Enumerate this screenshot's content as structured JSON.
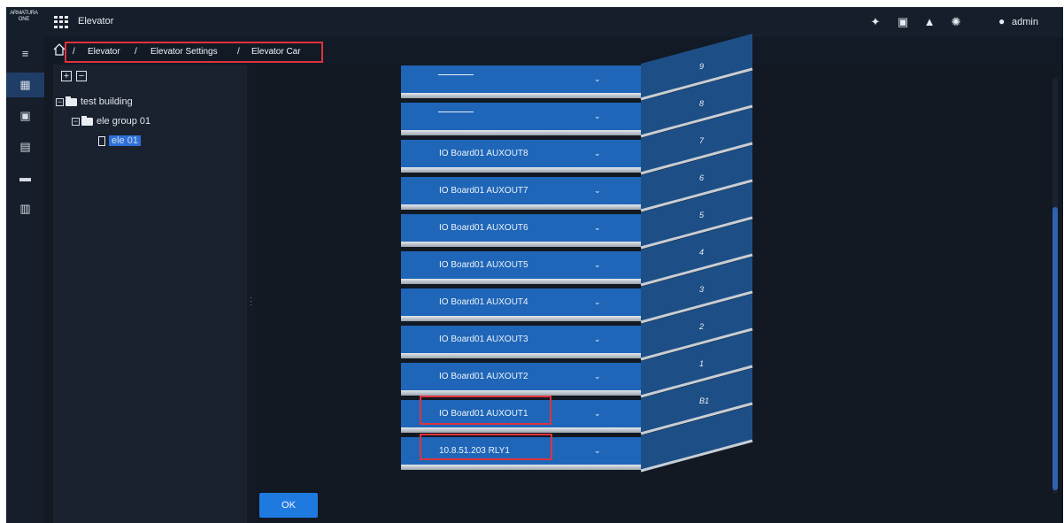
{
  "app": {
    "logo_line1": "ARMATURA",
    "logo_line2": "ONE",
    "title": "Elevator",
    "user": "admin"
  },
  "topbar_icons": [
    "pin-icon",
    "id-card-icon",
    "bell-icon",
    "alarm-icon",
    "user-icon"
  ],
  "left_nav": [
    {
      "name": "menu-toggle",
      "icon": "list-icon",
      "glyph": "≡"
    },
    {
      "name": "elevator",
      "icon": "building-icon",
      "glyph": "▦",
      "active": true
    },
    {
      "name": "monitor",
      "icon": "monitor-icon",
      "glyph": "▣"
    },
    {
      "name": "reports",
      "icon": "calendar-icon",
      "glyph": "▤"
    },
    {
      "name": "document",
      "icon": "document-icon",
      "glyph": "▬"
    },
    {
      "name": "access-levels",
      "icon": "calendar-edit-icon",
      "glyph": "▥"
    }
  ],
  "breadcrumb": {
    "items": [
      "Elevator",
      "Elevator Settings",
      "Elevator Car"
    ],
    "separator": "/"
  },
  "tree": {
    "expand_all": "+",
    "collapse_all": "−",
    "building": "test building",
    "group": "ele group 01",
    "elevator": "ele 01"
  },
  "floors": [
    {
      "floor": "9",
      "output": "———————"
    },
    {
      "floor": "8",
      "output": "———————"
    },
    {
      "floor": "7",
      "output": "IO Board01 AUXOUT8"
    },
    {
      "floor": "6",
      "output": "IO Board01 AUXOUT7"
    },
    {
      "floor": "5",
      "output": "IO Board01 AUXOUT6"
    },
    {
      "floor": "4",
      "output": "IO Board01 AUXOUT5"
    },
    {
      "floor": "3",
      "output": "IO Board01 AUXOUT4"
    },
    {
      "floor": "2",
      "output": "IO Board01 AUXOUT3"
    },
    {
      "floor": "1",
      "output": "IO Board01 AUXOUT2"
    },
    {
      "floor": "B1",
      "output": "IO Board01 AUXOUT1"
    },
    {
      "floor": "",
      "output": "10.8.51.203 RLY1"
    }
  ],
  "ok_label": "OK",
  "colors": {
    "accent": "#1f66b8",
    "highlight": "#e0323c",
    "background": "#121923"
  }
}
